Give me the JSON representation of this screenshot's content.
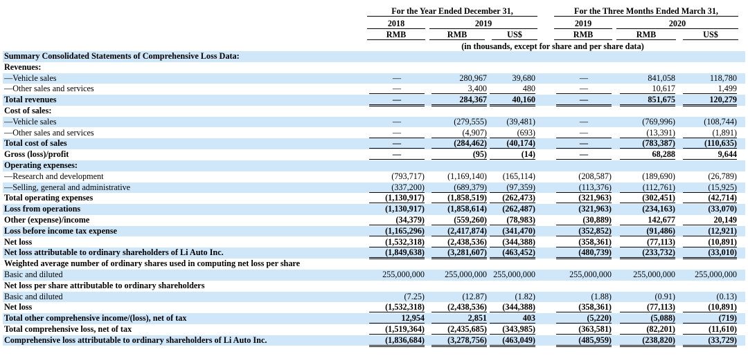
{
  "header": {
    "group1": "For the Year Ended December 31,",
    "group2": "For the Three Months Ended March 31,",
    "years": [
      "2018",
      "2019",
      "2019",
      "2020"
    ],
    "currencies": [
      "RMB",
      "RMB",
      "US$",
      "RMB",
      "RMB",
      "US$"
    ],
    "note": "(in thousands, except for share and per share data)"
  },
  "rows": [
    {
      "label": "Summary Consolidated Statements of Comprehensive Loss Data:",
      "bold": true,
      "values": []
    },
    {
      "label": "Revenues:",
      "bold": true,
      "values": []
    },
    {
      "label": "—Vehicle sales",
      "values": [
        "—",
        "280,967",
        "39,680",
        "—",
        "841,058",
        "118,780"
      ]
    },
    {
      "label": "—Other sales and services",
      "values": [
        "—",
        "3,400",
        "480",
        "—",
        "10,617",
        "1,499"
      ],
      "line": "bb"
    },
    {
      "label": "Total revenues",
      "bold": true,
      "values": [
        "—",
        "284,367",
        "40,160",
        "—",
        "851,675",
        "120,279"
      ],
      "line": "dbb"
    },
    {
      "label": "Cost of sales:",
      "bold": true,
      "values": []
    },
    {
      "label": "—Vehicle sales",
      "values": [
        "—",
        "(279,555)",
        "(39,481)",
        "—",
        "(769,996)",
        "(108,744)"
      ]
    },
    {
      "label": "—Other sales and services",
      "values": [
        "—",
        "(4,907)",
        "(693)",
        "—",
        "(13,391)",
        "(1,891)"
      ],
      "line": "bb"
    },
    {
      "label": "Total cost of sales",
      "bold": true,
      "values": [
        "—",
        "(284,462)",
        "(40,174)",
        "—",
        "(783,387)",
        "(110,635)"
      ],
      "line": "bb"
    },
    {
      "label": "Gross (loss)/profit",
      "bold": true,
      "values": [
        "—",
        "(95)",
        "(14)",
        "—",
        "68,288",
        "9,644"
      ],
      "line": "bb"
    },
    {
      "label": "Operating expenses:",
      "bold": true,
      "values": []
    },
    {
      "label": "—Research and development",
      "values": [
        "(793,717)",
        "(1,169,140)",
        "(165,114)",
        "(208,587)",
        "(189,690)",
        "(26,789)"
      ]
    },
    {
      "label": "—Selling, general and administrative",
      "values": [
        "(337,200)",
        "(689,379)",
        "(97,359)",
        "(113,376)",
        "(112,761)",
        "(15,925)"
      ],
      "line": "bb"
    },
    {
      "label": "Total operating expenses",
      "bold": true,
      "values": [
        "(1,130,917)",
        "(1,858,519)",
        "(262,473)",
        "(321,963)",
        "(302,451)",
        "(42,714)"
      ],
      "line": "bb"
    },
    {
      "label": "Loss from operations",
      "bold": true,
      "values": [
        "(1,130,917)",
        "(1,858,614)",
        "(262,487)",
        "(321,963)",
        "(234,163)",
        "(33,070)"
      ]
    },
    {
      "label": "Other (expense)/income",
      "bold": true,
      "values": [
        "(34,379)",
        "(559,260)",
        "(78,983)",
        "(30,889)",
        "142,677",
        "20,149"
      ],
      "line": "bb"
    },
    {
      "label": "Loss before income tax expense",
      "bold": true,
      "values": [
        "(1,165,296)",
        "(2,417,874)",
        "(341,470)",
        "(352,852)",
        "(91,486)",
        "(12,921)"
      ],
      "line": "bb"
    },
    {
      "label": "Net loss",
      "bold": true,
      "values": [
        "(1,532,318)",
        "(2,438,536)",
        "(344,388)",
        "(358,361)",
        "(77,113)",
        "(10,891)"
      ],
      "line": "dbb"
    },
    {
      "label": "Net loss attributable to ordinary shareholders of Li Auto Inc.",
      "bold": true,
      "values": [
        "(1,849,638)",
        "(3,281,607)",
        "(463,452)",
        "(480,739)",
        "(233,732)",
        "(33,010)"
      ],
      "line": "dbb"
    },
    {
      "label": "Weighted average number of ordinary shares used in computing net loss per share",
      "bold": true,
      "values": []
    },
    {
      "label": "Basic and diluted",
      "values": [
        "255,000,000",
        "255,000,000",
        "255,000,000",
        "255,000,000",
        "255,000,000",
        "255,000,000"
      ]
    },
    {
      "label": "Net loss per share attributable to ordinary shareholders",
      "bold": true,
      "values": []
    },
    {
      "label": "Basic and diluted",
      "values": [
        "(7.25)",
        "(12.87)",
        "(1.82)",
        "(1.88)",
        "(0.91)",
        "(0.13)"
      ]
    },
    {
      "label": "Net loss",
      "bold": true,
      "values": [
        "(1,532,318)",
        "(2,438,536)",
        "(344,388)",
        "(358,361)",
        "(77,113)",
        "(10,891)"
      ],
      "line": "bb"
    },
    {
      "label": "Total other comprehensive income/(loss), net of tax",
      "bold": true,
      "values": [
        "12,954",
        "2,851",
        "403",
        "(5,220)",
        "(5,088)",
        "(719)"
      ],
      "line": "bb"
    },
    {
      "label": "Total comprehensive loss, net of tax",
      "bold": true,
      "values": [
        "(1,519,364)",
        "(2,435,685)",
        "(343,985)",
        "(363,581)",
        "(82,201)",
        "(11,610)"
      ],
      "line": "dbb"
    },
    {
      "label": "Comprehensive loss attributable to ordinary shareholders of Li Auto Inc.",
      "bold": true,
      "values": [
        "(1,836,684)",
        "(3,278,756)",
        "(463,049)",
        "(485,959)",
        "(238,820)",
        "(33,729)"
      ],
      "line": "dbb"
    }
  ]
}
